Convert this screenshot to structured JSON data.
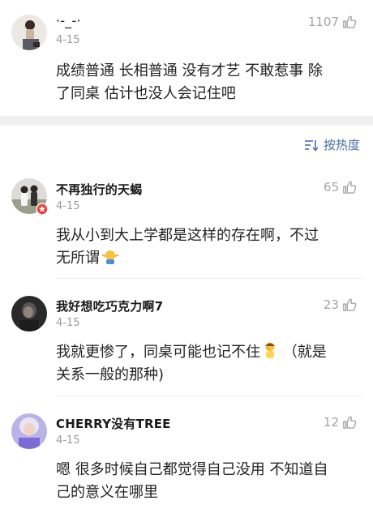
{
  "comments": [
    {
      "username": "·-_-·",
      "date": "4-15",
      "likes": "1107",
      "text_lines": [
        "成绩普通 长相普通 没有才艺 不敢惹事 除",
        "了同桌 估计也没人会记住吧"
      ]
    },
    {
      "username": "不再独行的天蝎",
      "date": "4-15",
      "likes": "65",
      "text_lines": [
        "我从小到大上学都是这样的存在啊，不过",
        "无所谓"
      ],
      "emoji": "shrug-emoji"
    },
    {
      "username": "我好想吃巧克力啊7",
      "date": "4-15",
      "likes": "23",
      "text_lines": [
        "我就更惨了，同桌可能也记不住",
        "（就是",
        "关系一般的那种)"
      ],
      "emoji": "facepalm-emoji"
    },
    {
      "username": "CHERRY没有TREE",
      "date": "4-15",
      "likes": "12",
      "text_lines": [
        "嗯 很多时候自己都觉得自己没用 不知道自",
        "己的意义在哪里"
      ]
    }
  ],
  "sort": {
    "label": "按热度",
    "icon": "sort-icon"
  },
  "colors": {
    "accent": "#4a6ea8",
    "muted": "#9b9b9b",
    "divider_band": "#f0f0f0",
    "verified_badge": "#e8423a"
  }
}
